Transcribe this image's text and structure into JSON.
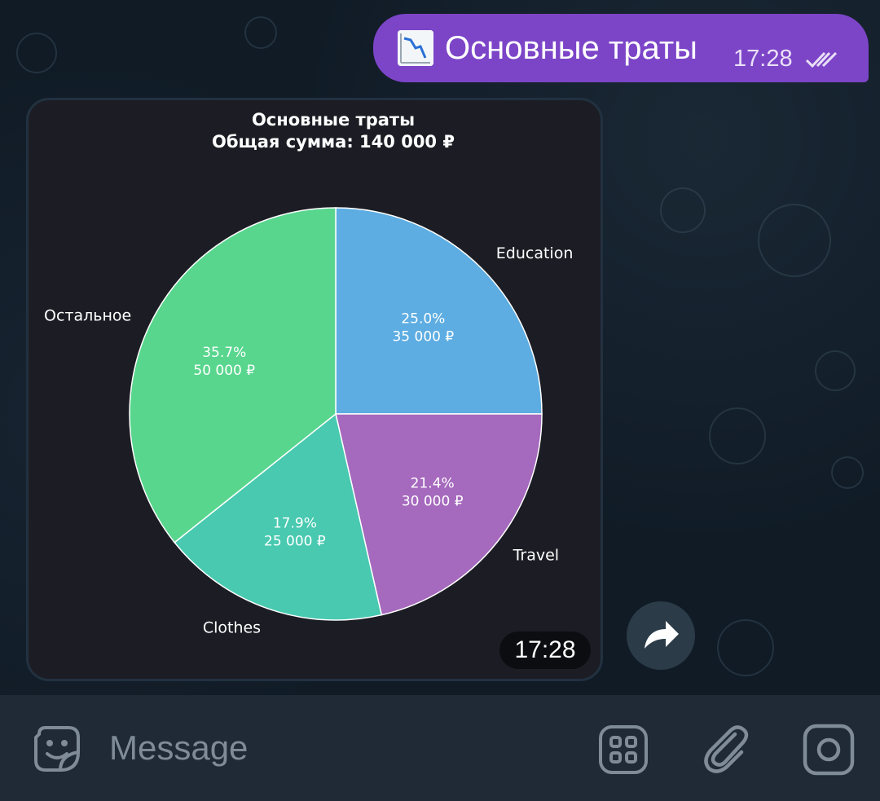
{
  "outgoing_message": {
    "text": "Основные траты",
    "time": "17:28",
    "icon": "chart-decreasing-emoji",
    "status_icon": "double-check-icon"
  },
  "image_message": {
    "time": "17:28"
  },
  "chart_data": {
    "type": "pie",
    "title": "Основные траты",
    "subtitle": "Общая сумма: 140 000 ₽",
    "slices": [
      {
        "label": "Education",
        "value": 35000,
        "percent": "25.0%",
        "amount": "35 000 ₽",
        "color": "#5dade2"
      },
      {
        "label": "Travel",
        "value": 30000,
        "percent": "21.4%",
        "amount": "30 000 ₽",
        "color": "#a569bd"
      },
      {
        "label": "Clothes",
        "value": 25000,
        "percent": "17.9%",
        "amount": "25 000 ₽",
        "color": "#48c9b0"
      },
      {
        "label": "Остальное",
        "value": 50000,
        "percent": "35.7%",
        "amount": "50 000 ₽",
        "color": "#58d68d"
      }
    ],
    "start_angle_deg": 90,
    "direction": "clockwise"
  },
  "share_button": {
    "icon": "share-arrow-icon"
  },
  "input_bar": {
    "placeholder": "Message",
    "sticker_icon": "sticker-icon",
    "commands_icon": "bot-commands-icon",
    "attach_icon": "paperclip-icon",
    "camera_icon": "camera-icon"
  },
  "colors": {
    "outgoing_bubble": "#7c45c8",
    "chat_background": "#101b26",
    "input_bar": "#1f2a36",
    "chart_background": "#1c1d24"
  }
}
